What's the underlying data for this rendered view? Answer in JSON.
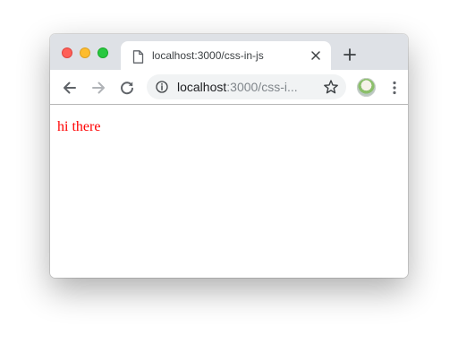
{
  "tab": {
    "title": "localhost:3000/css-in-js",
    "icon": "document-icon"
  },
  "address_bar": {
    "host": "localhost",
    "path_visible": ":3000/css-i...",
    "info_icon": "info-icon",
    "bookmark_icon": "star-icon"
  },
  "toolbar": {
    "back_icon": "back-arrow-icon",
    "forward_icon": "forward-arrow-icon",
    "reload_icon": "reload-icon",
    "menu_icon": "more-vertical-icon"
  },
  "page": {
    "text": "hi there",
    "text_color": "#ff0000"
  },
  "colors": {
    "titlebar": "#dee1e6",
    "omnibox": "#f1f3f4"
  }
}
